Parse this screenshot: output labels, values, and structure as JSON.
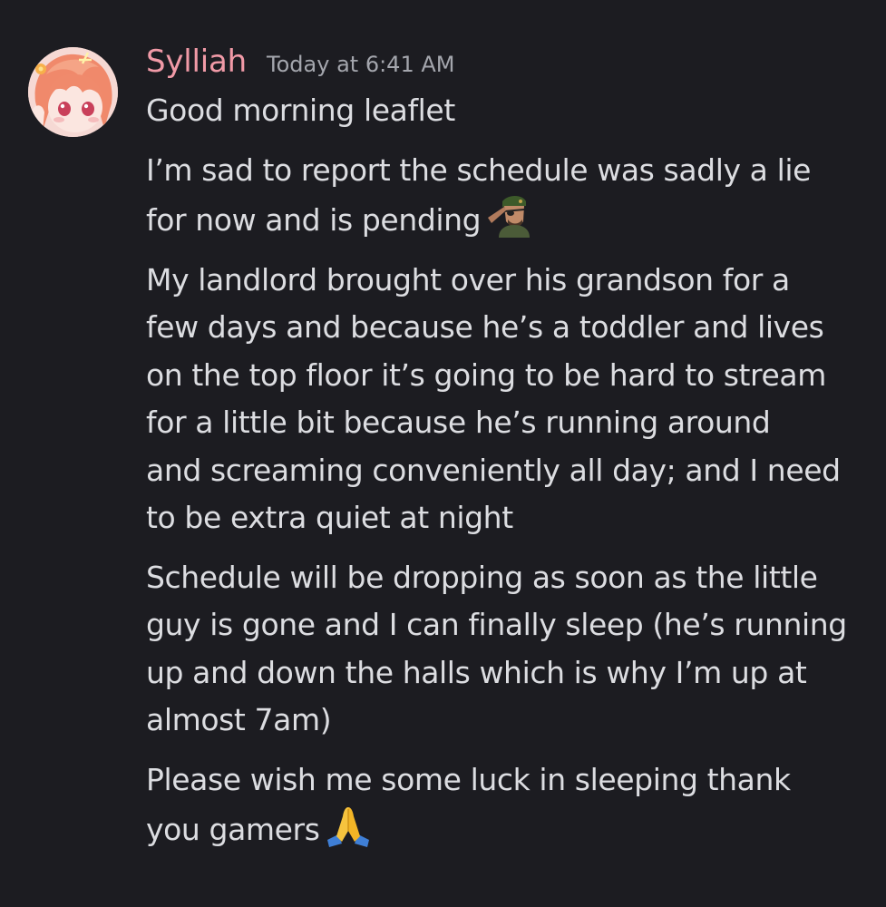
{
  "message": {
    "author": "Sylliah",
    "timestamp": "Today at 6:41 AM",
    "author_color": "#f19aa7",
    "paragraphs": [
      "Good morning leaflet",
      "I’m sad to report the schedule was sadly a lie\nfor now and is pending",
      "My landlord brought over his grandson for a\nfew days and because he’s a toddler and lives\non the top floor it’s going to be hard to stream\nfor a little bit because he’s running around\nand screaming conveniently all day; and I need\nto be extra quiet at night",
      "Schedule will be dropping as soon as the little\nguy is gone and I can finally sleep (he’s running\nup and down the halls which is why I’m up at\nalmost 7am)",
      "Please wish me some luck in sleeping thank\nyou gamers"
    ],
    "emojis": {
      "pending": "saluting-soldier-emoji",
      "gamers": "folded-hands-emoji"
    }
  }
}
